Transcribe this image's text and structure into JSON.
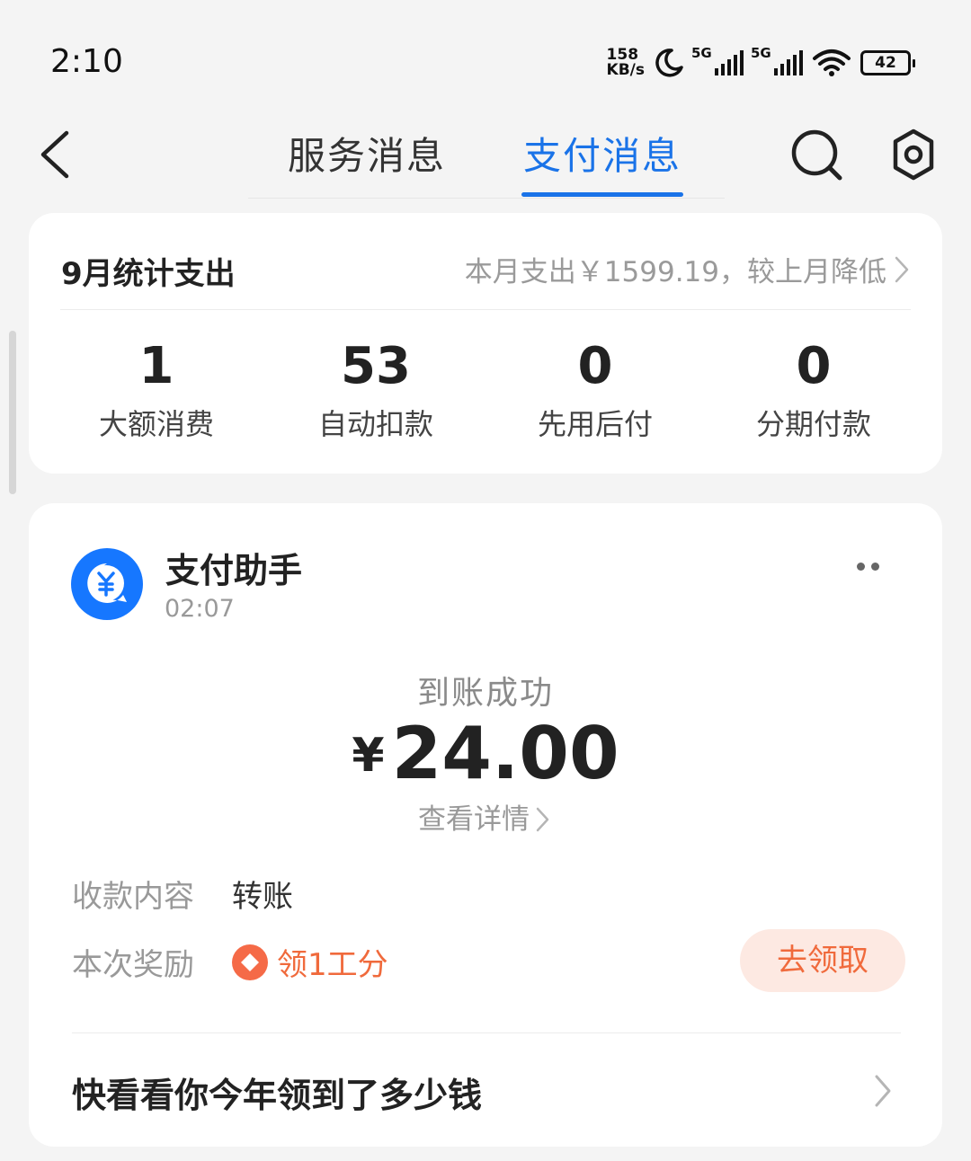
{
  "status_bar": {
    "time": "2:10",
    "speed_value": "158",
    "speed_unit": "KB/s",
    "network1": "5G",
    "network2": "5G",
    "battery": "42"
  },
  "header": {
    "tabs": [
      {
        "label": "服务消息",
        "active": false
      },
      {
        "label": "支付消息",
        "active": true
      }
    ]
  },
  "stats_card": {
    "title": "9月统计支出",
    "summary": "本月支出￥1599.19，较上月降低",
    "stats": [
      {
        "value": "1",
        "label": "大额消费"
      },
      {
        "value": "53",
        "label": "自动扣款"
      },
      {
        "value": "0",
        "label": "先用后付"
      },
      {
        "value": "0",
        "label": "分期付款"
      }
    ]
  },
  "message": {
    "sender": "支付助手",
    "time": "02:07",
    "status": "到账成功",
    "currency": "¥",
    "amount": "24.00",
    "detail_link": "查看详情",
    "rows": [
      {
        "key": "收款内容",
        "value": "转账"
      },
      {
        "key": "本次奖励",
        "value": "领1工分"
      }
    ],
    "claim_button": "去领取",
    "promo": "快看看你今年领到了多少钱"
  },
  "colors": {
    "accent": "#1a73e8",
    "reward": "#f06a3c",
    "claim_bg": "#fde9e2"
  }
}
